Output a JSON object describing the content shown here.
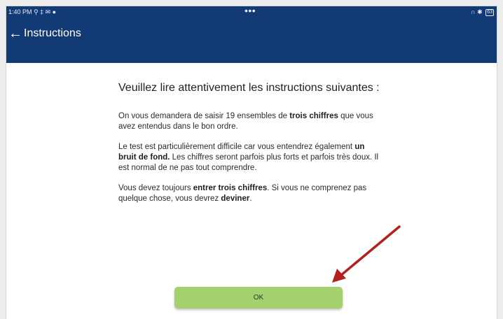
{
  "statusbar": {
    "time": "1:40 PM",
    "left_icons": "⚲ ‡ ✉ ●",
    "center": "•••",
    "right_icons": "∩ ✱",
    "battery": "63"
  },
  "appbar": {
    "back_glyph": "←",
    "title": "Instructions"
  },
  "content": {
    "heading": "Veuillez lire attentivement les instructions suivantes :",
    "p1_a": "On vous demandera de saisir 19 ensembles de ",
    "p1_b": "trois chiffres",
    "p1_c": " que vous avez entendus dans le bon ordre.",
    "p2_a": "Le test est particulièrement difficile car vous entendrez également ",
    "p2_b": "un bruit de fond.",
    "p2_c": " Les chiffres seront parfois plus forts et parfois très doux. Il est normal de ne pas tout comprendre.",
    "p3_a": "Vous devez toujours ",
    "p3_b": "entrer trois chiffres",
    "p3_c": ". Si vous ne comprenez pas quelque chose, vous devrez ",
    "p3_d": "deviner",
    "p3_e": "."
  },
  "ok_button": {
    "label": "OK"
  },
  "colors": {
    "header": "#123a74",
    "button": "#a4d16e",
    "arrow": "#b3201e"
  },
  "icons": [
    "arrow-back-icon",
    "wifi-icon",
    "headphones-icon",
    "bluetooth-icon",
    "battery-icon",
    "annotation-arrow-icon"
  ]
}
